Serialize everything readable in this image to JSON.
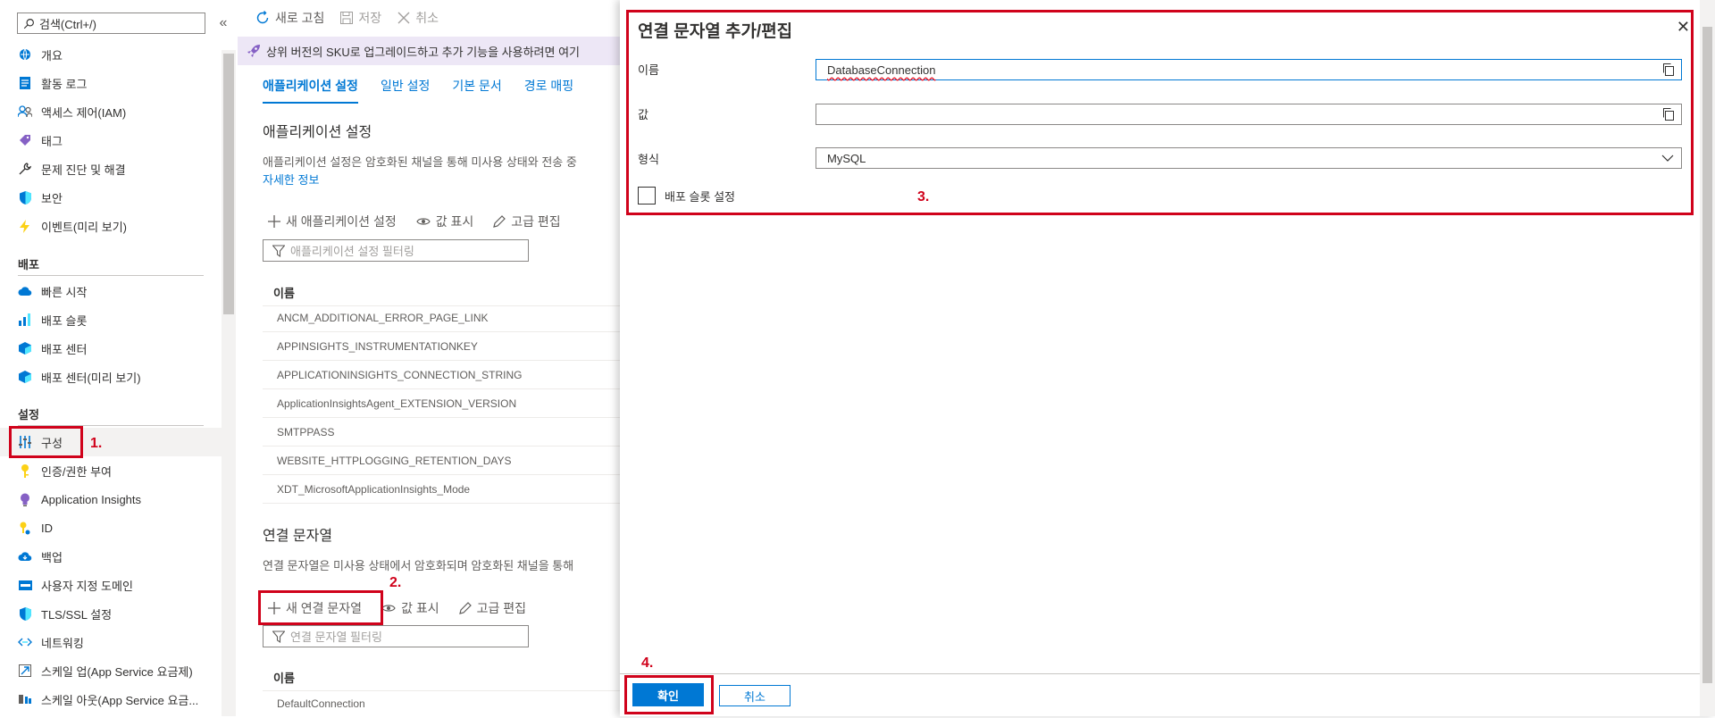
{
  "sidebar": {
    "search_placeholder": "검색(Ctrl+/)",
    "items": [
      {
        "label": "개요",
        "icon": "globe-icon"
      },
      {
        "label": "활동 로그",
        "icon": "log-icon"
      },
      {
        "label": "액세스 제어(IAM)",
        "icon": "people-icon"
      },
      {
        "label": "태그",
        "icon": "tag-icon"
      },
      {
        "label": "문제 진단 및 해결",
        "icon": "wrench-icon"
      },
      {
        "label": "보안",
        "icon": "shield-icon"
      },
      {
        "label": "이벤트(미리 보기)",
        "icon": "lightning-icon"
      }
    ],
    "section_deploy": "배포",
    "deploy_items": [
      {
        "label": "빠른 시작",
        "icon": "cloud-icon"
      },
      {
        "label": "배포 슬롯",
        "icon": "slots-icon"
      },
      {
        "label": "배포 센터",
        "icon": "cube-icon"
      },
      {
        "label": "배포 센터(미리 보기)",
        "icon": "cube-icon"
      }
    ],
    "section_settings": "설정",
    "settings_items": [
      {
        "label": "구성",
        "icon": "sliders-icon"
      },
      {
        "label": "인증/권한 부여",
        "icon": "key-icon"
      },
      {
        "label": "Application Insights",
        "icon": "lightbulb-icon"
      },
      {
        "label": "ID",
        "icon": "identity-icon"
      },
      {
        "label": "백업",
        "icon": "backup-cloud-icon"
      },
      {
        "label": "사용자 지정 도메인",
        "icon": "domain-icon"
      },
      {
        "label": "TLS/SSL 설정",
        "icon": "shield-icon"
      },
      {
        "label": "네트워킹",
        "icon": "network-icon"
      },
      {
        "label": "스케일 업(App Service 요금제)",
        "icon": "scale-up-icon"
      },
      {
        "label": "스케일 아웃(App Service 요금...",
        "icon": "scale-out-icon"
      }
    ]
  },
  "toolbar": {
    "refresh": "새로 고침",
    "save": "저장",
    "discard": "취소"
  },
  "banner": {
    "text": "상위 버전의 SKU로 업그레이드하고 추가 기능을 사용하려면 여기"
  },
  "tabs": [
    "애플리케이션 설정",
    "일반 설정",
    "기본 문서",
    "경로 매핑"
  ],
  "app_settings": {
    "title": "애플리케이션 설정",
    "description": "애플리케이션 설정은 암호화된 채널을 통해 미사용 상태와 전송 중",
    "learn_more": "자세한 정보",
    "new_button": "새 애플리케이션 설정",
    "show_values": "값 표시",
    "advanced_edit": "고급 편집",
    "filter_placeholder": "애플리케이션 설정 필터링",
    "col_name": "이름",
    "rows": [
      "ANCM_ADDITIONAL_ERROR_PAGE_LINK",
      "APPINSIGHTS_INSTRUMENTATIONKEY",
      "APPLICATIONINSIGHTS_CONNECTION_STRING",
      "ApplicationInsightsAgent_EXTENSION_VERSION",
      "SMTPPASS",
      "WEBSITE_HTTPLOGGING_RETENTION_DAYS",
      "XDT_MicrosoftApplicationInsights_Mode"
    ]
  },
  "conn_strings": {
    "title": "연결 문자열",
    "description": "연결 문자열은 미사용 상태에서 암호화되며 암호화된 채널을 통해",
    "new_button": "새 연결 문자열",
    "show_values": "값 표시",
    "advanced_edit": "고급 편집",
    "filter_placeholder": "연결 문자열 필터링",
    "col_name": "이름",
    "rows": [
      "DefaultConnection"
    ]
  },
  "panel": {
    "title": "연결 문자열 추가/편집",
    "name_label": "이름",
    "name_value": "DatabaseConnection",
    "value_label": "값",
    "value_value": "",
    "type_label": "형식",
    "type_value": "MySQL",
    "slot_setting_label": "배포 슬롯 설정",
    "ok": "확인",
    "cancel": "취소"
  },
  "annotations": [
    "1.",
    "2.",
    "3.",
    "4."
  ],
  "colors": {
    "accent": "#0078d4",
    "annotation_red": "#d0021b",
    "banner_bg": "#ede7f6"
  }
}
